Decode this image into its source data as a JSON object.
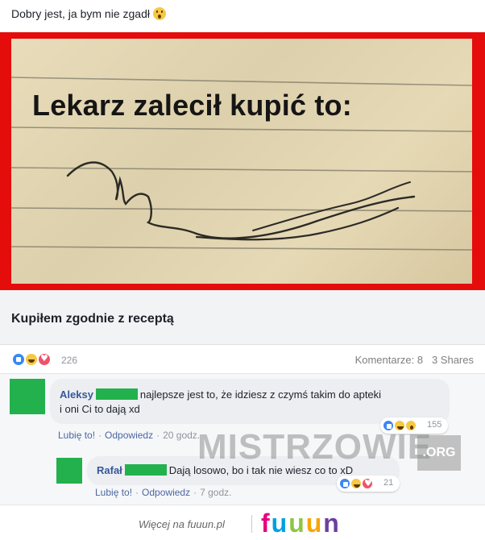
{
  "header": {
    "text": "Dobry jest, ja bym nie zgadł",
    "emoji": "wow-emoji"
  },
  "image": {
    "title": "Lekarz zalecił kupić to:",
    "frame_color": "#e50c0c"
  },
  "caption": {
    "text": "Kupiłem zgodnie z receptą"
  },
  "reactions": {
    "count": "226",
    "comments": "Komentarze: 8",
    "shares": "3 Shares"
  },
  "comments": [
    {
      "author": "Aleksy",
      "text_line1": "najlepsze jest to, że idziesz z czymś takim do apteki",
      "text_line2": "i oni Ci to dają xd",
      "like": "Lubię to!",
      "reply": "Odpowiedz",
      "time": "20 godz.",
      "reactions_count": "155"
    },
    {
      "author": "Rafał",
      "text": "Dają losowo, bo i tak nie wiesz co to xD",
      "like": "Lubię to!",
      "reply": "Odpowiedz",
      "time": "7 godz.",
      "reactions_count": "21"
    }
  ],
  "watermark": {
    "text": "MISTRZOWIE",
    "suffix": ".ORG"
  },
  "footer": {
    "more": "Więcej na fuuun.pl",
    "brand_letters": [
      "f",
      "u",
      "u",
      "u",
      "n"
    ],
    "brand_colors": [
      "#e6007e",
      "#00a0e3",
      "#8cc63f",
      "#f7a600",
      "#6b3fa0"
    ]
  },
  "colors": {
    "link": "#365899",
    "avatar": "#22b14c",
    "like": "#3b86f5",
    "love": "#f0526b",
    "haha": "#f7c844"
  }
}
